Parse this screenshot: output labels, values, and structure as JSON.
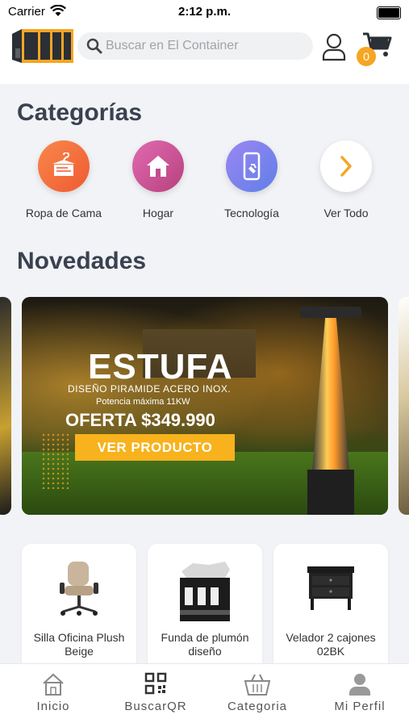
{
  "status_bar": {
    "carrier": "Carrier",
    "time": "2:12 p.m."
  },
  "header": {
    "search_placeholder": "Buscar en El Container",
    "cart_count": "0"
  },
  "categories": {
    "title": "Categorías",
    "items": [
      {
        "label": "Ropa de Cama",
        "icon": "bedding-icon",
        "color": "#f26b3a"
      },
      {
        "label": "Hogar",
        "icon": "home-icon",
        "color": "#d04f9a"
      },
      {
        "label": "Tecnología",
        "icon": "phone-icon",
        "color": "#7b7bf0"
      },
      {
        "label": "Ver Todo",
        "icon": "chevron-right-icon",
        "color": "#f5a623"
      }
    ]
  },
  "news": {
    "title": "Novedades",
    "banner": {
      "title": "ESTUFA",
      "subtitle": "DISEÑO PIRAMIDE ACERO INOX.",
      "power": "Potencia máxima 11KW",
      "offer": "OFERTA $349.990",
      "button": "VER PRODUCTO"
    }
  },
  "products": [
    {
      "name": "Silla Oficina Plush Beige",
      "icon": "office-chair-icon"
    },
    {
      "name": "Funda de plumón diseño",
      "icon": "duvet-icon"
    },
    {
      "name": "Velador 2 cajones 02BK",
      "icon": "nightstand-icon"
    }
  ],
  "tabbar": {
    "items": [
      {
        "label": "Inicio",
        "icon": "home-icon"
      },
      {
        "label": "BuscarQR",
        "icon": "qr-code-icon"
      },
      {
        "label": "Categoria",
        "icon": "basket-icon"
      },
      {
        "label": "Mi Perfil",
        "icon": "user-icon"
      }
    ]
  },
  "colors": {
    "accent": "#f5a623",
    "title": "#3a4150"
  }
}
